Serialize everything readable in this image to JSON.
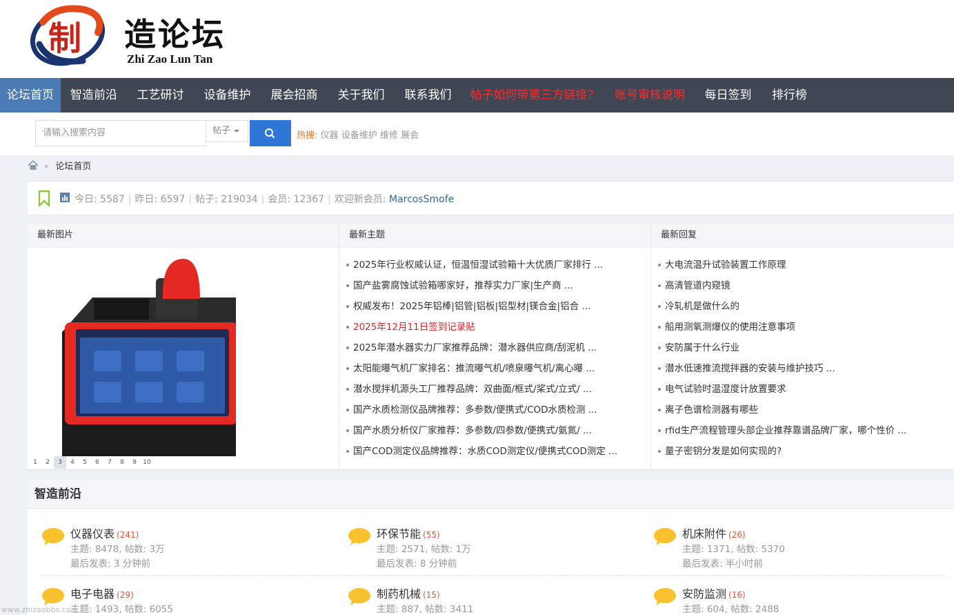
{
  "logo": {
    "title": "造论坛",
    "subtitle": "Zhi Zao Lun Tan",
    "badge_char": "制"
  },
  "nav": {
    "items": [
      {
        "label": "论坛首页",
        "active": true
      },
      {
        "label": "智造前沿"
      },
      {
        "label": "工艺研讨"
      },
      {
        "label": "设备维护"
      },
      {
        "label": "展会招商"
      },
      {
        "label": "关于我们"
      },
      {
        "label": "联系我们"
      },
      {
        "label": "帖子如何带第三方链接?",
        "highlight": true
      },
      {
        "label": "账号审核说明",
        "highlight": true
      },
      {
        "label": "每日签到"
      },
      {
        "label": "排行榜"
      }
    ]
  },
  "search": {
    "placeholder": "请输入搜索内容",
    "type": "帖子",
    "hot_label": "热搜:",
    "hot_keywords": [
      "仪器",
      "设备维护",
      "维修",
      "展会"
    ]
  },
  "breadcrumb": {
    "current": "论坛首页"
  },
  "stats": {
    "today": "今日: 5587",
    "yesterday": "昨日: 6597",
    "posts": "帖子: 219034",
    "members": "会员: 12367",
    "welcome": "欢迎新会员:",
    "newest_member": "MarcosSmofe"
  },
  "latest_images": {
    "title": "最新图片",
    "pages": [
      "1",
      "2",
      "3",
      "4",
      "5",
      "6",
      "7",
      "8",
      "9",
      "10"
    ],
    "current_page": "3"
  },
  "latest_threads": {
    "title": "最新主题",
    "items": [
      "2025年行业权威认证，恒温恒湿试验箱十大优质厂家排行 ...",
      "国产盐雾腐蚀试验箱哪家好，推荐实力厂家|生产商 ...",
      "权威发布！2025年铝棒|铝管|铝板|铝型材|镁合金|铝合 ...",
      "2025年12月11日签到记录贴",
      "2025年潜水器实力厂家推荐品牌：潜水器供应商/刮泥机 ...",
      "太阳能曝气机厂家排名：推流曝气机/喷泉曝气机/离心曝 ...",
      "潜水搅拌机源头工厂推荐品牌：双曲面/框式/桨式/立式/ ...",
      "国产水质检测仪品牌推荐：多参数/便携式/COD水质检测 ...",
      "国产水质分析仪厂家推荐：多参数/四参数/便携式/氨氮/ ...",
      "国产COD测定仪品牌推荐：水质COD测定仪/便携式COD测定 ..."
    ],
    "red_index": 3
  },
  "latest_replies": {
    "title": "最新回复",
    "items": [
      "大电流温升试验装置工作原理",
      "高清管道内窥镜",
      "冷轧机是做什么的",
      "船用测氧测爆仪的使用注意事项",
      "安防属于什么行业",
      "潜水低速推流搅拌器的安装与维护技巧 ...",
      "电气试验时温湿度计放置要求",
      "离子色谱检测器有哪些",
      "rfid生产流程管理头部企业推荐靠谱品牌厂家，哪个性价 ...",
      "量子密钥分发是如何实现的?"
    ]
  },
  "section": {
    "title": "智造前沿",
    "forums": [
      {
        "name": "仪器仪表",
        "count": "(241)",
        "stats": "主题: 8478, 帖数: 3万",
        "last": "最后发表: 3 分钟前"
      },
      {
        "name": "环保节能",
        "count": "(55)",
        "stats": "主题: 2571, 帖数: 1万",
        "last": "最后发表: 8 分钟前"
      },
      {
        "name": "机床附件",
        "count": "(26)",
        "stats": "主题: 1371, 帖数: 5370",
        "last": "最后发表: 半小时前"
      },
      {
        "name": "电子电器",
        "count": "(29)",
        "stats": "主题: 1493, 帖数: 6055",
        "last": ""
      },
      {
        "name": "制药机械",
        "count": "(15)",
        "stats": "主题: 887, 帖数: 3411",
        "last": ""
      },
      {
        "name": "安防监测",
        "count": "(16)",
        "stats": "主题: 604, 帖数: 2488",
        "last": ""
      }
    ]
  },
  "watermark": "www.zhizaobbs.com",
  "colors": {
    "nav_bg": "#3f4654",
    "nav_active": "#4b7bb5",
    "nav_highlight": "#ff2a2a",
    "search_btn": "#2e77d6",
    "hot_label": "#e8752c",
    "bubble": "#f7c22d",
    "link_blue": "#336699"
  }
}
